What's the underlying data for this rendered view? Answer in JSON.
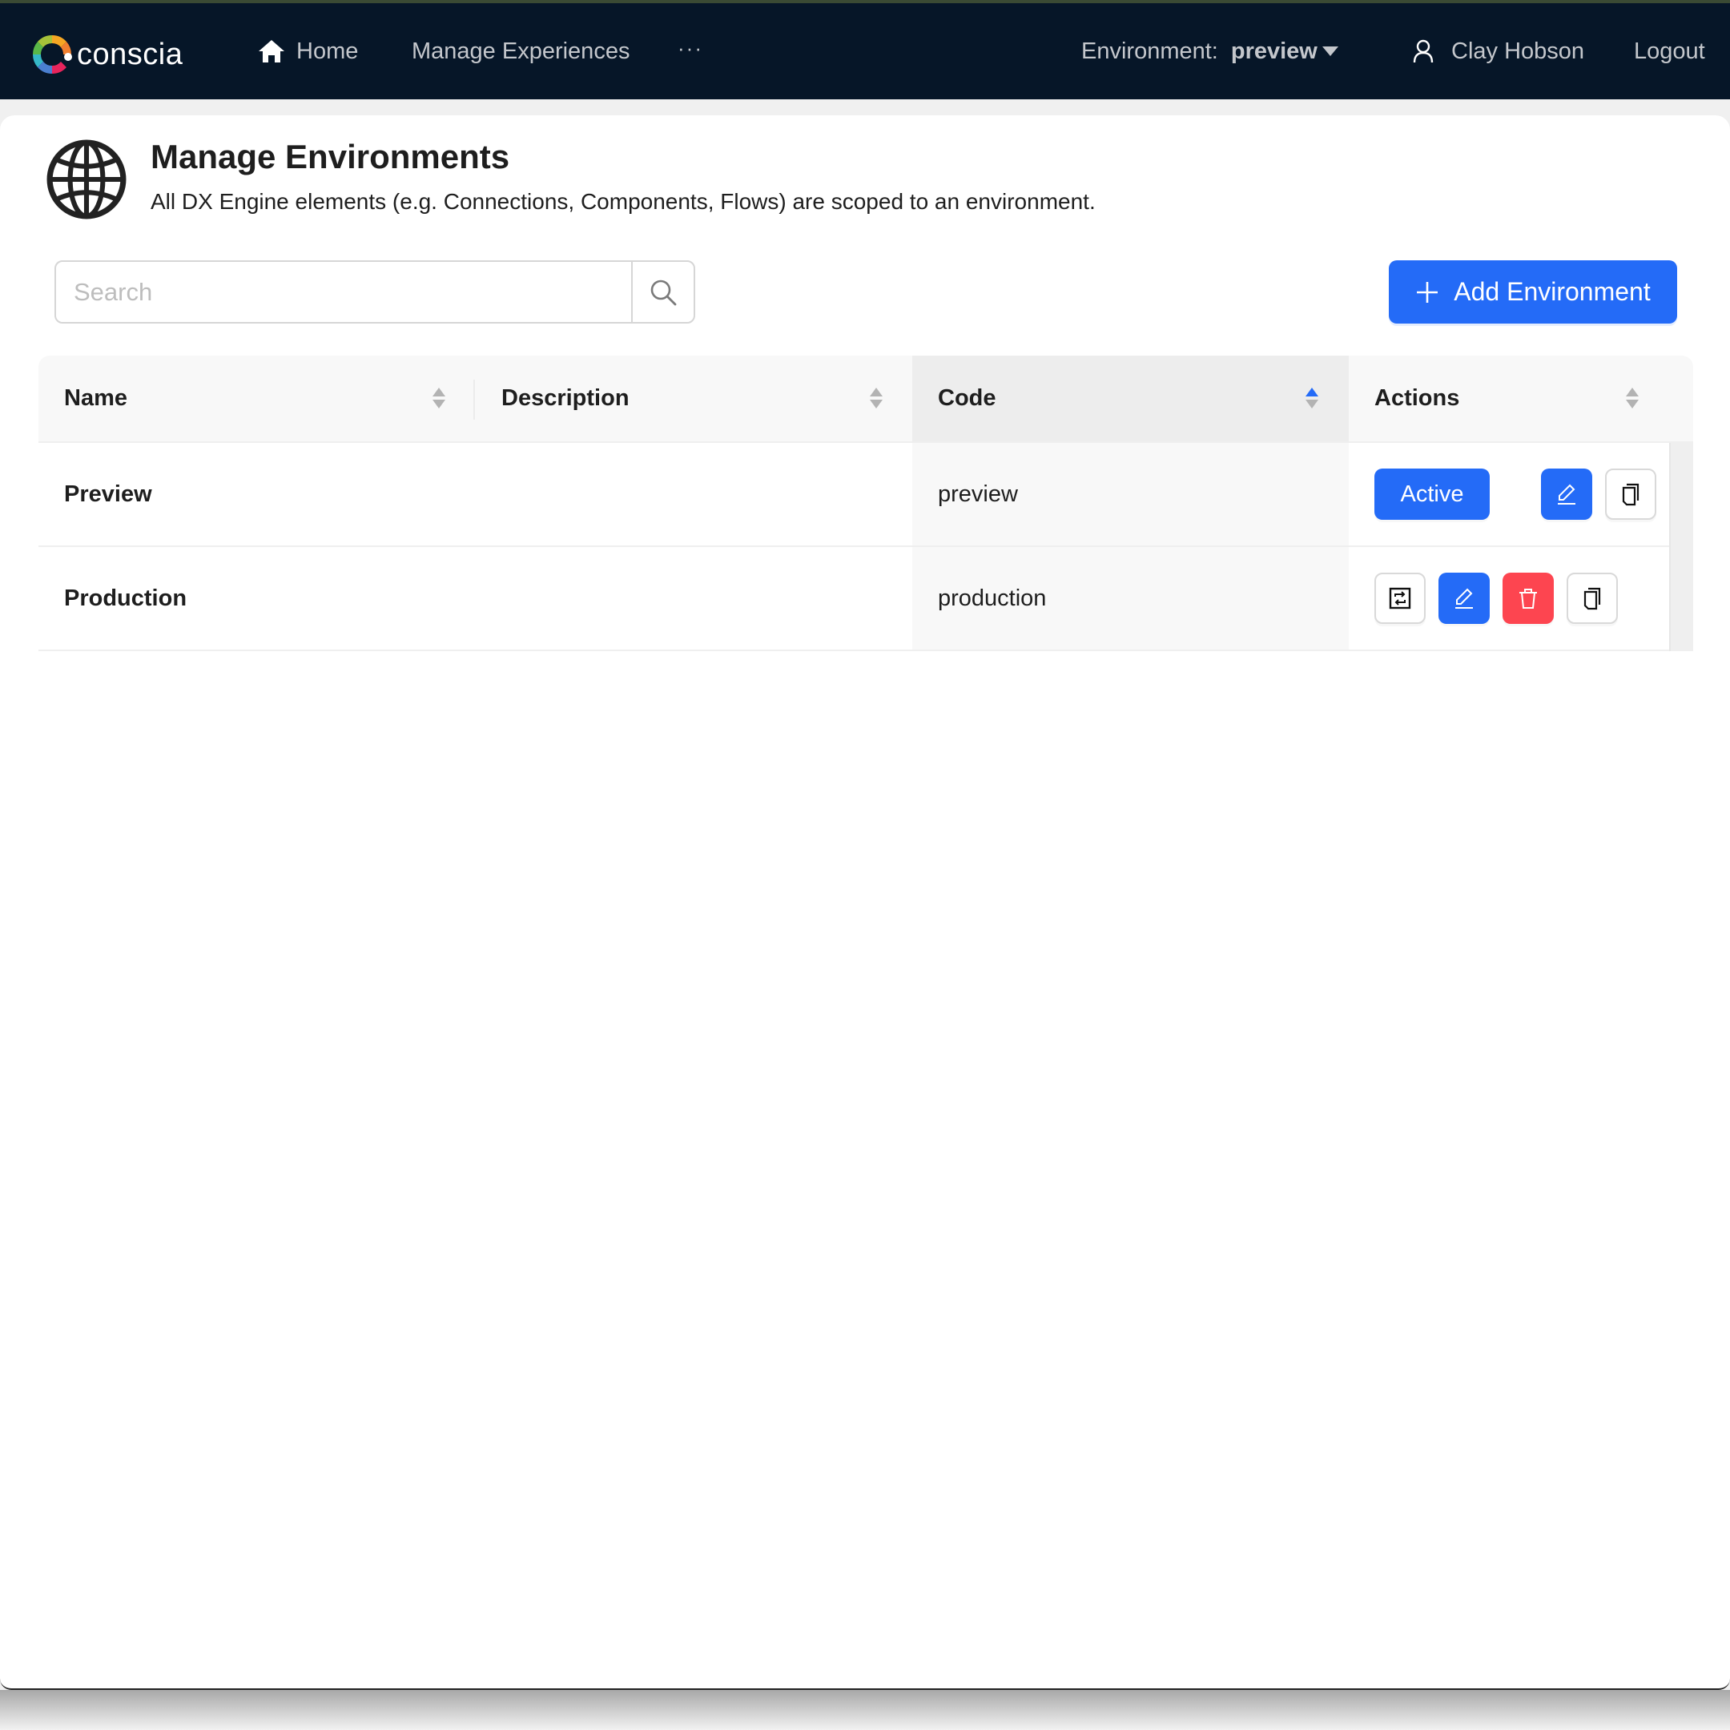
{
  "nav": {
    "logo_text": "conscia",
    "items": [
      {
        "label": "Home",
        "icon": "home-icon"
      },
      {
        "label": "Manage Experiences"
      },
      {
        "label": "···",
        "icon": "more-icon"
      }
    ],
    "environment_label": "Environment:",
    "environment_value": "preview",
    "user_name": "Clay Hobson",
    "logout_label": "Logout"
  },
  "page": {
    "icon": "globe-icon",
    "title": "Manage Environments",
    "subtitle": "All DX Engine elements (e.g. Connections, Components, Flows) are scoped to an environment."
  },
  "search": {
    "placeholder": "Search",
    "value": ""
  },
  "add_button": {
    "label": "Add Environment",
    "icon": "plus-icon"
  },
  "table": {
    "columns": [
      {
        "label": "Name",
        "sort": "none"
      },
      {
        "label": "Description",
        "sort": "none"
      },
      {
        "label": "Code",
        "sort": "ascending"
      },
      {
        "label": "Actions",
        "sort": "none"
      }
    ],
    "rows": [
      {
        "name": "Preview",
        "description": "",
        "code": "preview",
        "actions": [
          {
            "type": "active",
            "label": "Active"
          },
          {
            "type": "edit",
            "icon": "edit-icon"
          },
          {
            "type": "copy",
            "icon": "copy-icon"
          }
        ]
      },
      {
        "name": "Production",
        "description": "",
        "code": "production",
        "actions": [
          {
            "type": "switch",
            "icon": "switch-icon"
          },
          {
            "type": "edit",
            "icon": "edit-icon"
          },
          {
            "type": "delete",
            "icon": "trash-icon"
          },
          {
            "type": "copy",
            "icon": "copy-icon"
          }
        ]
      }
    ]
  },
  "colors": {
    "nav_bg": "#061628",
    "primary": "#246bf7",
    "danger": "#fd4550"
  }
}
